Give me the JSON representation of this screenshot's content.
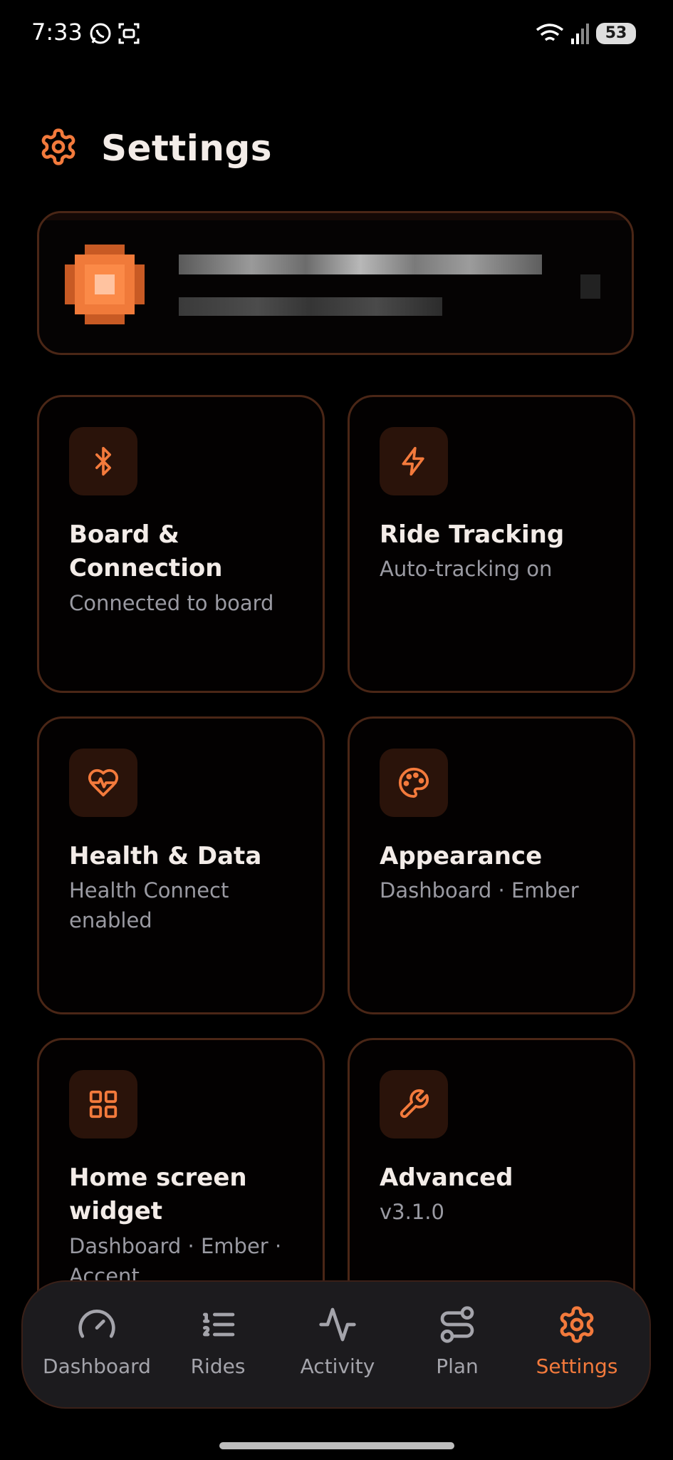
{
  "status_bar": {
    "time": "7:33",
    "battery": "53"
  },
  "header": {
    "title": "Settings"
  },
  "colors": {
    "accent": "#f37a3c",
    "card_border": "#4a2616",
    "icon_bg": "#2a130a",
    "muted": "#9a9aa2"
  },
  "cards": [
    {
      "title": "Board & Connection",
      "subtitle": "Connected to board",
      "icon": "bluetooth-icon"
    },
    {
      "title": "Ride Tracking",
      "subtitle": "Auto-tracking on",
      "icon": "lightning-icon"
    },
    {
      "title": "Health & Data",
      "subtitle": "Health Connect enabled",
      "icon": "heart-pulse-icon"
    },
    {
      "title": "Appearance",
      "subtitle": "Dashboard · Ember",
      "icon": "palette-icon"
    },
    {
      "title": "Home screen widget",
      "subtitle": "Dashboard · Ember · Accent",
      "icon": "grid-icon"
    },
    {
      "title": "Advanced",
      "subtitle": "v3.1.0",
      "icon": "wrench-icon"
    }
  ],
  "nav": {
    "items": [
      {
        "label": "Dashboard",
        "icon": "gauge-icon"
      },
      {
        "label": "Rides",
        "icon": "list-icon"
      },
      {
        "label": "Activity",
        "icon": "activity-icon"
      },
      {
        "label": "Plan",
        "icon": "route-icon"
      },
      {
        "label": "Settings",
        "icon": "gear-icon"
      }
    ],
    "active": "Settings"
  }
}
